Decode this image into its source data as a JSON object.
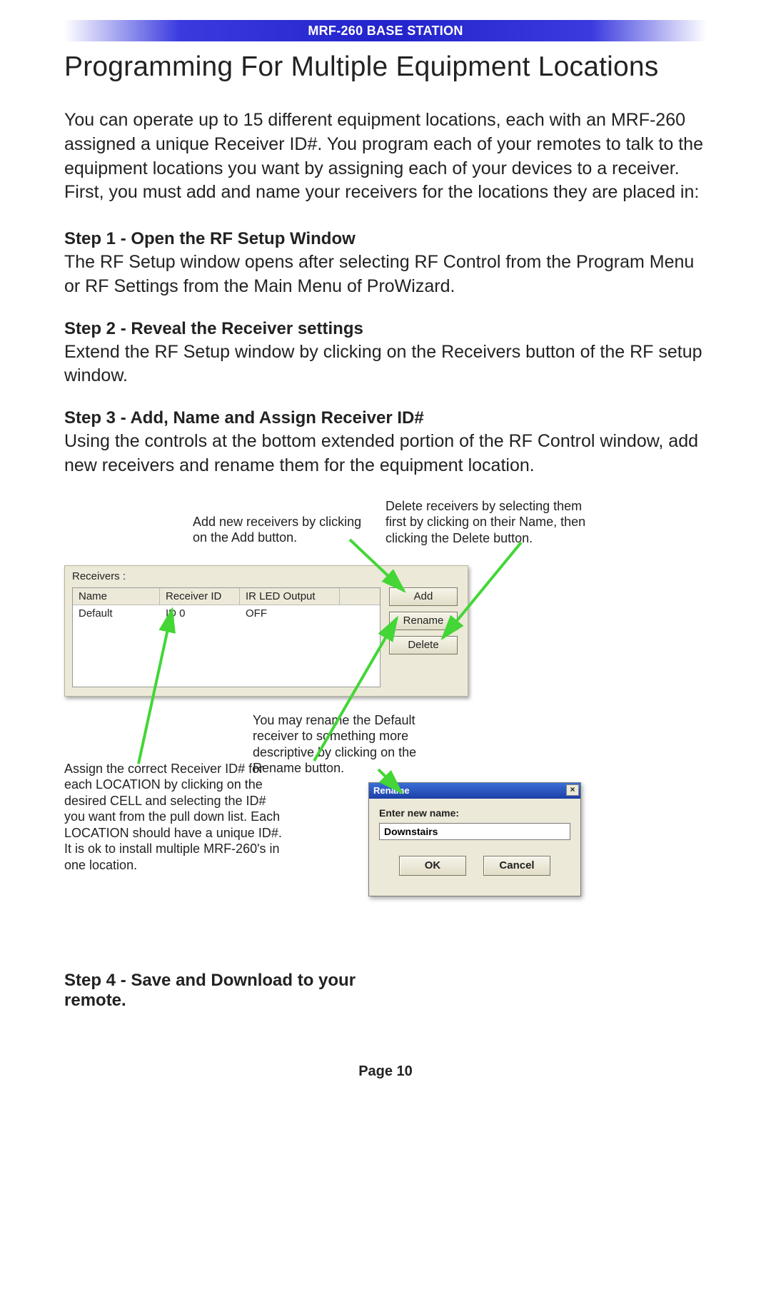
{
  "header": "MRF-260 BASE STATION",
  "title": "Programming For Multiple Equipment Locations",
  "intro": "You can operate up to 15 different equipment locations, each with an MRF-260 assigned a unique Receiver ID#.  You program each of your remotes to talk to the equipment locations you want by assigning each of your devices to a receiver. First, you must add and name your receivers for the locations they are placed in:",
  "steps": {
    "s1": {
      "head": "Step 1 - Open the RF Setup Window",
      "body": "The RF Setup window opens after selecting RF Control from the Program Menu or RF Settings from the Main Menu of ProWizard."
    },
    "s2": {
      "head": "Step 2 - Reveal the Receiver settings",
      "body": "Extend the RF Setup window by clicking on the Receivers button of the RF setup window."
    },
    "s3": {
      "head": "Step 3 - Add, Name and Assign Receiver ID#",
      "body": "Using the controls at the bottom extended portion of the RF Control window, add new receivers and rename them for the equipment location."
    },
    "s4": {
      "head": "Step 4 - Save and Download to your remote."
    }
  },
  "callouts": {
    "add": "Add new receivers by clicking on the Add button.",
    "delete": "Delete receivers by selecting them first by clicking on their Name, then clicking the Delete button.",
    "rename": "You may rename the Default receiver to something more descriptive by clicking on the Rename button.",
    "assign": "Assign the correct Receiver ID# for each LOCATION by clicking on the desired CELL and selecting the ID# you want from the pull down list. Each LOCATION should have a unique ID#.  It is ok to install multiple MRF-260's in one location."
  },
  "receivers": {
    "label": "Receivers :",
    "columns": {
      "name": "Name",
      "id": "Receiver ID",
      "led": "IR LED Output"
    },
    "rows": [
      {
        "name": "Default",
        "id": "ID 0",
        "led": "OFF"
      }
    ],
    "buttons": {
      "add": "Add",
      "rename": "Rename",
      "delete": "Delete"
    }
  },
  "dialog": {
    "title": "Rename",
    "close": "×",
    "label": "Enter new name:",
    "value": "Downstairs",
    "ok": "OK",
    "cancel": "Cancel"
  },
  "pageNumber": "Page 10"
}
